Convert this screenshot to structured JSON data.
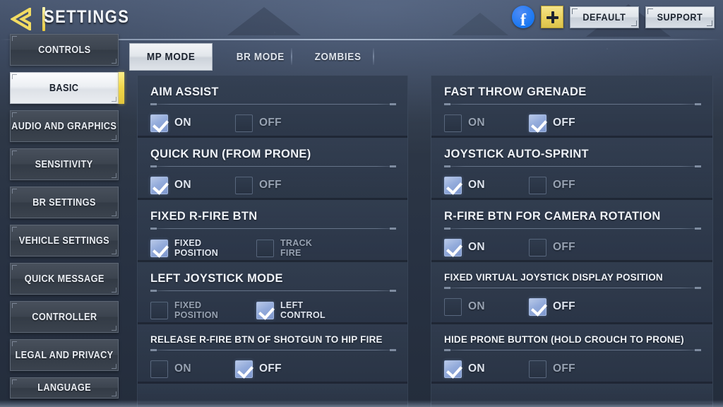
{
  "header": {
    "back_icon": "back-chevron-icon",
    "title": "SETTINGS",
    "facebook_icon": "facebook-icon",
    "facebook_glyph": "f",
    "add_icon": "plus-icon",
    "default_label": "DEFAULT",
    "support_label": "SUPPORT"
  },
  "sidebar": {
    "items": [
      {
        "label": "CONTROLS",
        "active": false
      },
      {
        "label": "BASIC",
        "active": true
      },
      {
        "label": "AUDIO AND GRAPHICS",
        "active": false
      },
      {
        "label": "SENSITIVITY",
        "active": false
      },
      {
        "label": "BR SETTINGS",
        "active": false
      },
      {
        "label": "VEHICLE SETTINGS",
        "active": false
      },
      {
        "label": "QUICK MESSAGE",
        "active": false
      },
      {
        "label": "CONTROLLER",
        "active": false
      },
      {
        "label": "LEGAL AND PRIVACY",
        "active": false
      },
      {
        "label": "LANGUAGE",
        "active": false
      }
    ]
  },
  "tabs": [
    {
      "label": "MP MODE",
      "active": true
    },
    {
      "label": "BR MODE",
      "active": false
    },
    {
      "label": "ZOMBIES",
      "active": false
    }
  ],
  "settings": {
    "left_column": [
      {
        "title": "AIM ASSIST",
        "options": [
          {
            "label": "ON",
            "checked": true
          },
          {
            "label": "OFF",
            "checked": false
          }
        ]
      },
      {
        "title": "QUICK RUN (FROM PRONE)",
        "options": [
          {
            "label": "ON",
            "checked": true
          },
          {
            "label": "OFF",
            "checked": false
          }
        ]
      },
      {
        "title": "FIXED R-FIRE BTN",
        "options": [
          {
            "label": "FIXED\nPOSITION",
            "checked": true
          },
          {
            "label": "TRACK\nFIRE",
            "checked": false
          }
        ]
      },
      {
        "title": "LEFT JOYSTICK MODE",
        "options": [
          {
            "label": "FIXED\nPOSITION",
            "checked": false
          },
          {
            "label": "LEFT\nCONTROL",
            "checked": true
          }
        ]
      },
      {
        "title": "RELEASE R-FIRE BTN OF SHOTGUN TO HIP FIRE",
        "small_title": true,
        "options": [
          {
            "label": "ON",
            "checked": false
          },
          {
            "label": "OFF",
            "checked": true
          }
        ]
      }
    ],
    "right_column": [
      {
        "title": "FAST THROW GRENADE",
        "options": [
          {
            "label": "ON",
            "checked": false
          },
          {
            "label": "OFF",
            "checked": true
          }
        ]
      },
      {
        "title": "JOYSTICK AUTO-SPRINT",
        "options": [
          {
            "label": "ON",
            "checked": true
          },
          {
            "label": "OFF",
            "checked": false
          }
        ]
      },
      {
        "title": "R-FIRE BTN FOR CAMERA ROTATION",
        "options": [
          {
            "label": "ON",
            "checked": true
          },
          {
            "label": "OFF",
            "checked": false
          }
        ]
      },
      {
        "title": "FIXED VIRTUAL JOYSTICK DISPLAY POSITION",
        "small_title": true,
        "options": [
          {
            "label": "ON",
            "checked": false
          },
          {
            "label": "OFF",
            "checked": true
          }
        ]
      },
      {
        "title": "HIDE PRONE BUTTON (HOLD CROUCH TO PRONE)",
        "small_title": true,
        "options": [
          {
            "label": "ON",
            "checked": true
          },
          {
            "label": "OFF",
            "checked": false
          }
        ]
      }
    ]
  },
  "colors": {
    "accent_yellow": "#f0d648",
    "checkbox_checked": "#93abdb",
    "panel_bg": "#2c3748",
    "page_bg": "#2e3847",
    "facebook_blue": "#1877f2"
  }
}
